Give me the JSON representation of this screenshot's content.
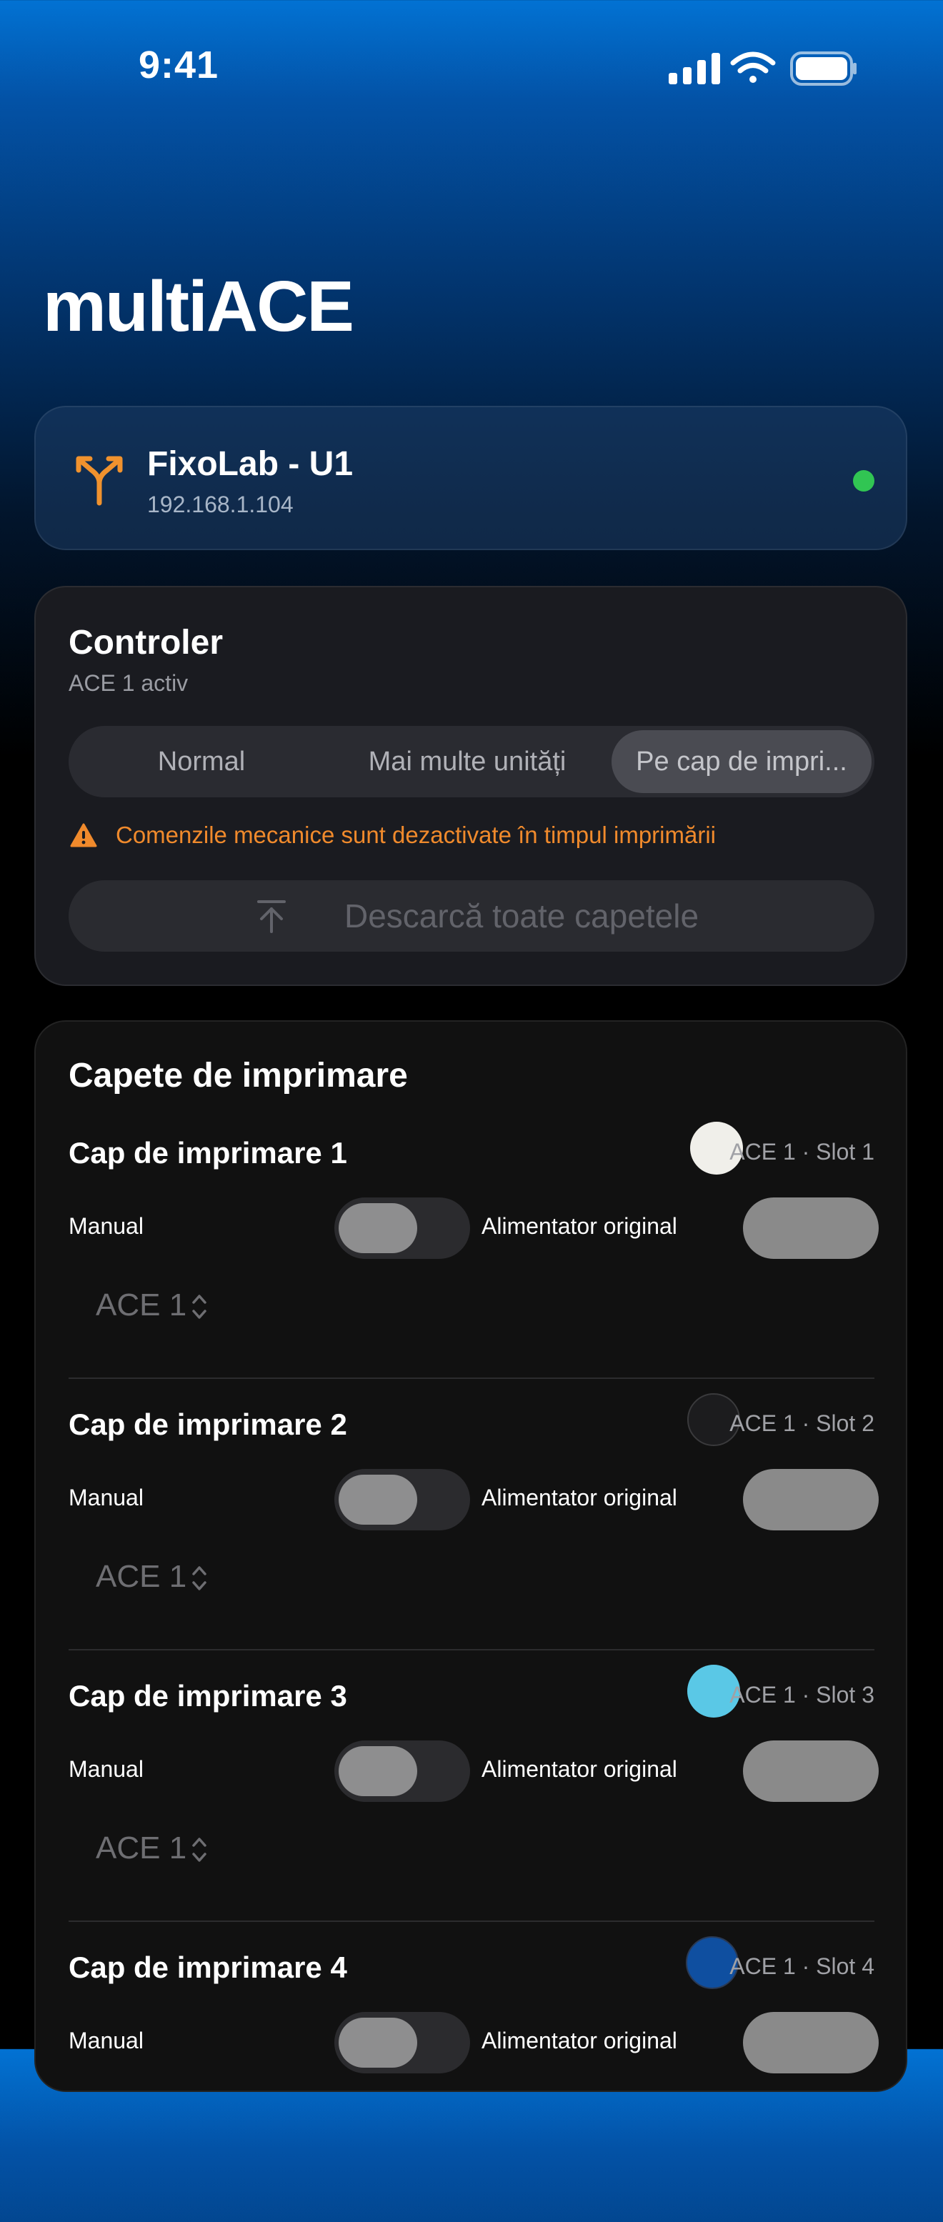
{
  "status_bar": {
    "time": "9:41"
  },
  "title": "multiACE",
  "device": {
    "name": "FixoLab - U1",
    "ip": "192.168.1.104",
    "status_color": "#31c553",
    "icon": "fork-arrow-icon"
  },
  "controller": {
    "title": "Controler",
    "subtitle": "ACE 1 activ",
    "modes": [
      "Normal",
      "Mai multe unități",
      "Pe cap de impri..."
    ],
    "selected_mode": "Pe cap de impri...",
    "warning": "Comenzile mecanice sunt dezactivate în timpul imprimării",
    "unload_all": "Descarcă toate capetele"
  },
  "heads_section": {
    "title": "Capete de imprimare",
    "manual_label": "Manual",
    "feeder_label": "Alimentator original",
    "heads": [
      {
        "name": "Cap de imprimare 1",
        "slot": "ACE 1 · Slot 1",
        "color": "#f0efea",
        "ace": "ACE 1",
        "manual": false
      },
      {
        "name": "Cap de imprimare 2",
        "slot": "ACE 1 · Slot 2",
        "color": "#1c1c1e",
        "ace": "ACE 1",
        "manual": false
      },
      {
        "name": "Cap de imprimare 3",
        "slot": "ACE 1 · Slot 3",
        "color": "#5ac8e6",
        "ace": "ACE 1",
        "manual": false
      },
      {
        "name": "Cap de imprimare 4",
        "slot": "ACE 1 · Slot 4",
        "color": "#0f4fa0",
        "ace": "ACE 1",
        "manual": false
      }
    ]
  }
}
